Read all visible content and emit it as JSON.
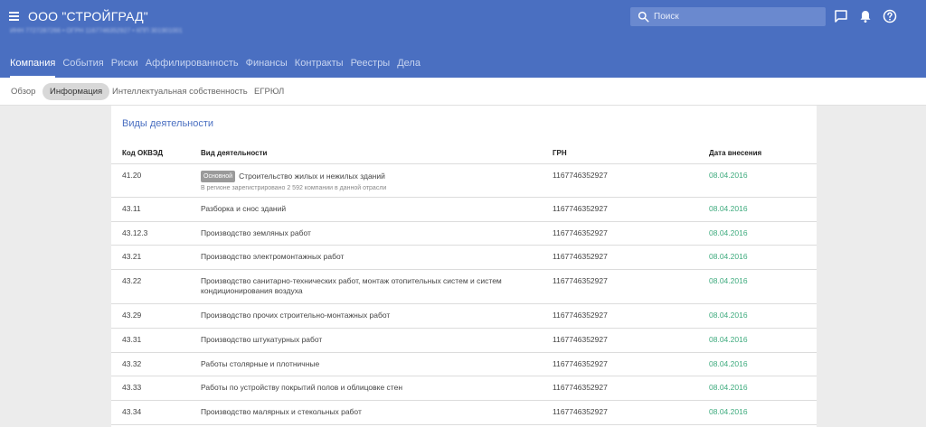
{
  "header": {
    "company_name": "ООО \"СТРОЙГРАД\"",
    "blurred_info": "ИНН 7727287266 • ОГРН 1167746352927 • КПП 301901001",
    "search_placeholder": "Поиск"
  },
  "tabs": [
    {
      "label": "Компания",
      "active": true
    },
    {
      "label": "События",
      "active": false
    },
    {
      "label": "Риски",
      "active": false
    },
    {
      "label": "Аффилированность",
      "active": false
    },
    {
      "label": "Финансы",
      "active": false
    },
    {
      "label": "Контракты",
      "active": false
    },
    {
      "label": "Реестры",
      "active": false
    },
    {
      "label": "Дела",
      "active": false
    }
  ],
  "subtabs": [
    {
      "label": "Обзор",
      "active": false
    },
    {
      "label": "Информация",
      "active": true
    },
    {
      "label": "Интеллектуальная собственность",
      "active": false
    },
    {
      "label": "ЕГРЮЛ",
      "active": false
    }
  ],
  "section": {
    "title": "Виды деятельности",
    "columns": [
      "Код ОКВЭД",
      "Вид деятельности",
      "ГРН",
      "Дата внесения"
    ],
    "rows": [
      {
        "code": "41.20",
        "badge": "Основной",
        "activity": "Строительство жилых и нежилых зданий",
        "note": "В регионе зарегистрировано 2 592 компании в данной отрасли",
        "grn": "1167746352927",
        "date": "08.04.2016"
      },
      {
        "code": "43.11",
        "activity": "Разборка и снос зданий",
        "grn": "1167746352927",
        "date": "08.04.2016"
      },
      {
        "code": "43.12.3",
        "activity": "Производство земляных работ",
        "grn": "1167746352927",
        "date": "08.04.2016"
      },
      {
        "code": "43.21",
        "activity": "Производство электромонтажных работ",
        "grn": "1167746352927",
        "date": "08.04.2016"
      },
      {
        "code": "43.22",
        "activity": "Производство санитарно-технических работ, монтаж отопительных систем и систем кондиционирования воздуха",
        "grn": "1167746352927",
        "date": "08.04.2016"
      },
      {
        "code": "43.29",
        "activity": "Производство прочих строительно-монтажных работ",
        "grn": "1167746352927",
        "date": "08.04.2016"
      },
      {
        "code": "43.31",
        "activity": "Производство штукатурных работ",
        "grn": "1167746352927",
        "date": "08.04.2016"
      },
      {
        "code": "43.32",
        "activity": "Работы столярные и плотничные",
        "grn": "1167746352927",
        "date": "08.04.2016"
      },
      {
        "code": "43.33",
        "activity": "Работы по устройству покрытий полов и облицовке стен",
        "grn": "1167746352927",
        "date": "08.04.2016"
      },
      {
        "code": "43.34",
        "activity": "Производство малярных и стекольных работ",
        "grn": "1167746352927",
        "date": "08.04.2016"
      }
    ]
  },
  "icons": [
    "menu-icon",
    "search-icon",
    "chat-icon",
    "bell-icon",
    "help-icon"
  ],
  "colors": {
    "header_bg": "#4a6fc1",
    "date_green": "#3daa7d",
    "title_blue": "#4a6fc1"
  }
}
